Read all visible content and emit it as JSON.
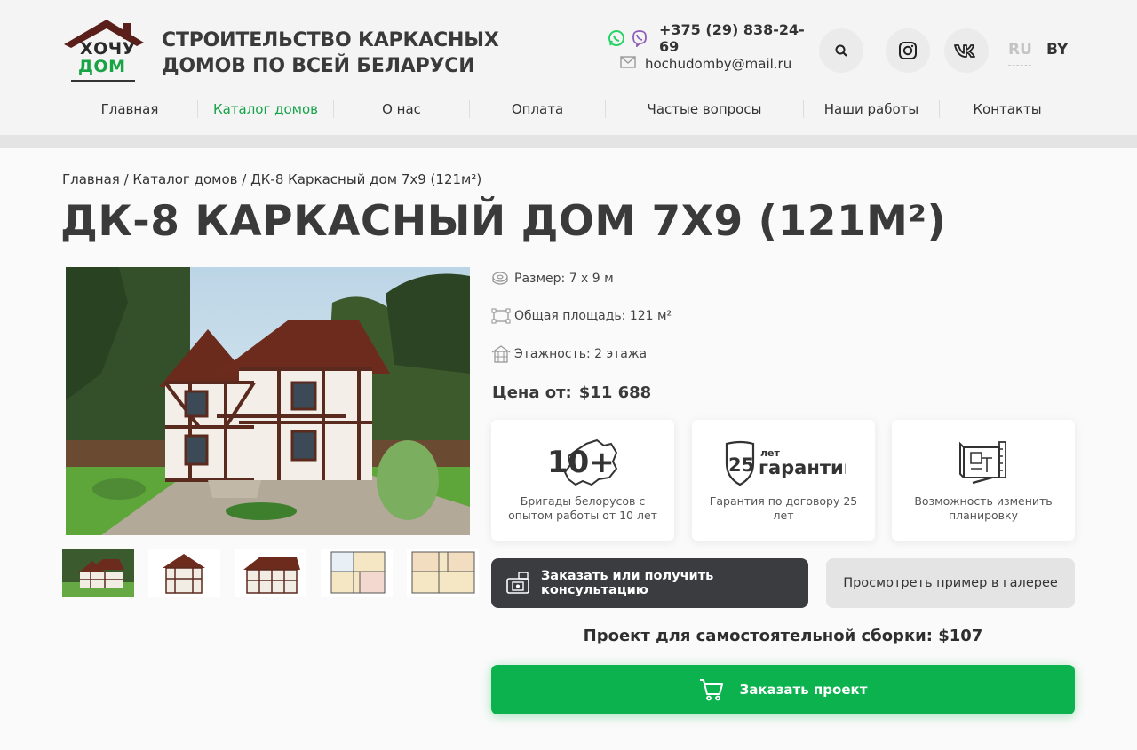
{
  "header": {
    "logo": {
      "word1": "ХОЧУ",
      "word2": "ДОМ"
    },
    "tagline": "СТРОИТЕЛЬСТВО КАРКАСНЫХ ДОМОВ ПО ВСЕЙ БЕЛАРУСИ",
    "phone": "+375 (29) 838-24-69",
    "email": "hochudomby@mail.ru",
    "lang_ru": "RU",
    "lang_by": "BY",
    "icons": [
      "whatsapp-icon",
      "viber-icon",
      "mail-icon",
      "search-icon",
      "instagram-icon",
      "vk-icon"
    ],
    "colors": {
      "accent_green": "#18a24a",
      "whatsapp": "#25d366",
      "viber": "#8f5db7"
    }
  },
  "nav": {
    "items": [
      {
        "label": "Главная",
        "active": false
      },
      {
        "label": "Каталог домов",
        "active": true
      },
      {
        "label": "О нас",
        "active": false
      },
      {
        "label": "Оплата",
        "active": false
      },
      {
        "label": "Частые вопросы",
        "active": false
      },
      {
        "label": "Наши работы",
        "active": false
      },
      {
        "label": "Контакты",
        "active": false
      }
    ]
  },
  "breadcrumb": {
    "home": "Главная",
    "sep": " / ",
    "catalog": "Каталог домов",
    "current": "ДК-8 Каркасный дом 7х9 (121м²)"
  },
  "product": {
    "title": "ДК-8 КАРКАСНЫЙ ДОМ 7Х9 (121М²)",
    "specs": {
      "size": "Размер: 7 х 9 м",
      "area": "Общая площадь: 121 м²",
      "floors": "Этажность: 2 этажа"
    },
    "price_label": "Цена от:",
    "price_value": "$11 688",
    "thumbnails": [
      "facade-render",
      "front-elevation",
      "side-elevation",
      "floor-plan-1",
      "floor-plan-2"
    ]
  },
  "features": [
    {
      "big": "10+",
      "caption": "Бригады белорусов с опытом работы от 10 лет"
    },
    {
      "big": "25",
      "small_top": "лет",
      "small_bottom": "гарантии",
      "caption": "Гарантия по договору 25 лет"
    },
    {
      "caption": "Возможность изменить планировку"
    }
  ],
  "actions": {
    "consult_label": "Заказать или получить консультацию",
    "gallery_label": "Просмотреть пример в галерее",
    "self_build_label": "Проект для самостоятельной сборки: $107",
    "order_label": "Заказать проект"
  }
}
